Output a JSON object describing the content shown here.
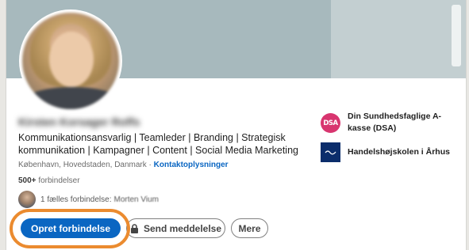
{
  "profile": {
    "name": "Kirsten Korsager Roffs",
    "headline": "Kommunikationsansvarlig | Teamleder | Branding | Strategisk kommunikation | Kampagner | Content | Social Media Marketing",
    "location": "København, Hovedstaden, Danmark",
    "location_separator": "·",
    "contact_link": "Kontaktoplysninger",
    "connections_count": "500+",
    "connections_label": "forbindelser",
    "mutual_label": "1 fælles forbindelse:",
    "mutual_name": "Morten Vium"
  },
  "actions": {
    "connect_label": "Opret forbindelse",
    "message_label": "Send meddelelse",
    "more_label": "Mere"
  },
  "experience": [
    {
      "label": "Din Sundhedsfaglige A-kasse (DSA)",
      "logo_text": "DSA",
      "logo": "dsa-logo"
    },
    {
      "label": "Handelshøjskolen i Århus",
      "logo": "aarhus-logo"
    }
  ],
  "colors": {
    "primary": "#0a66c2",
    "highlight": "#eb8b2f",
    "cover": "#a7b9bd",
    "dsa": "#d8356f",
    "aarhus": "#0b2d6b"
  }
}
